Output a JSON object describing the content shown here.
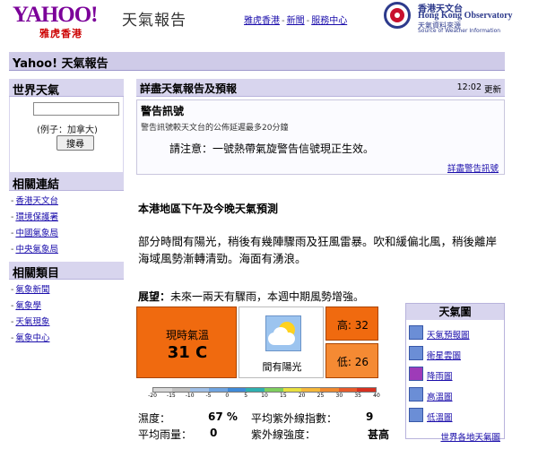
{
  "header": {
    "logo_text": "YAHOO!",
    "logo_sub": "雅虎香港",
    "title": "天氣報告",
    "links": [
      "雅虎香港",
      "新聞",
      "服務中心"
    ],
    "hko_cn": "香港天文台",
    "hko_en": "Hong Kong Observatory",
    "hko_cn2": "天氣資料來源",
    "hko_sub": "Source of Weather Information"
  },
  "title_bar": {
    "text": "Yahoo!  天氣報告"
  },
  "left": {
    "world_title": "世界天氣",
    "search_hint": "(例子：加拿大)",
    "search_button": "搜尋",
    "links_title": "相關連結",
    "links": [
      "香港天文台",
      "環境保護署",
      "中國氣象局",
      "中央氣象局"
    ],
    "categories_title": "相關類目",
    "categories": [
      "氣象新聞",
      "氣象學",
      "天氣現象",
      "氣象中心"
    ]
  },
  "main": {
    "heading": "詳盡天氣報告及預報",
    "time": "12:02",
    "refresh": "更新",
    "warning_title": "警告訊號",
    "warning_note": "警告訊號較天文台的公佈延遲最多20分鐘",
    "warning_msg": "請注意：一號熱帶氣旋警告信號現正生效。",
    "warning_link": "詳盡警告訊號",
    "forecast_title": "本港地區下午及今晚天氣預測",
    "forecast_text": "部分時間有陽光，稍後有幾陣驟雨及狂風雷暴。吹和緩偏北風，稍後離岸海域風勢漸轉清勁。海面有湧浪。",
    "outlook_label": "展望：",
    "outlook_text": "未來一兩天有驟雨，本週中期風勢增強。"
  },
  "weather": {
    "temp_label": "現時氣溫",
    "temp_value": "31 C",
    "condition": "間有陽光",
    "condition_icon": "sun-cloud-icon",
    "high": "高: 32",
    "low": "低:  26",
    "scale_ticks": [
      "-20",
      "-15",
      "-10",
      "-5",
      "0",
      "5",
      "10",
      "15",
      "20",
      "25",
      "30",
      "35",
      "40"
    ],
    "scale_colors": [
      "#d8d8d8",
      "#c0c0c0",
      "#9fbfe6",
      "#6fa4e0",
      "#3f8ad8",
      "#2fb0b0",
      "#7fcf5f",
      "#e8e03f",
      "#f5b83a",
      "#f08a2f",
      "#e85a2a",
      "#d8301f"
    ],
    "humidity_label": "濕度：",
    "humidity_value": "67 %",
    "uv_avg_label": "平均紫外線指數：",
    "uv_avg_value": "9",
    "rain_label": "平均雨量：",
    "rain_value": "0",
    "uv_level_label": "紫外線強度：",
    "uv_level_value": "甚高"
  },
  "maps": {
    "title": "天氣圖",
    "items": [
      "天氣預報圖",
      "衛星雲圖",
      "降雨圖",
      "高溫圖",
      "低溫圖"
    ],
    "world_link": "世界各地天氣圖"
  }
}
